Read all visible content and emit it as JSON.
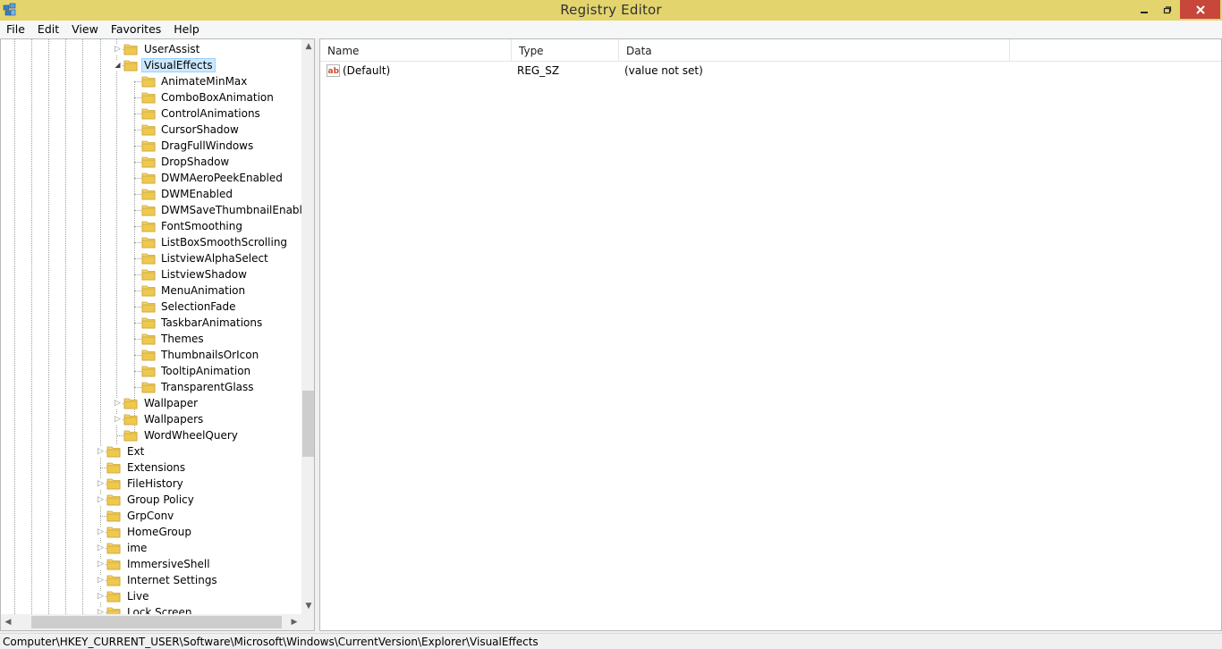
{
  "window": {
    "title": "Registry Editor"
  },
  "menu": [
    "File",
    "Edit",
    "View",
    "Favorites",
    "Help"
  ],
  "tree": {
    "rows": [
      {
        "label": "UserAssist",
        "level": 1,
        "expander": "collapsed",
        "selected": false
      },
      {
        "label": "VisualEffects",
        "level": 1,
        "expander": "expanded",
        "selected": true
      },
      {
        "label": "AnimateMinMax",
        "level": 2,
        "expander": "none",
        "selected": false
      },
      {
        "label": "ComboBoxAnimation",
        "level": 2,
        "expander": "none",
        "selected": false
      },
      {
        "label": "ControlAnimations",
        "level": 2,
        "expander": "none",
        "selected": false
      },
      {
        "label": "CursorShadow",
        "level": 2,
        "expander": "none",
        "selected": false
      },
      {
        "label": "DragFullWindows",
        "level": 2,
        "expander": "none",
        "selected": false
      },
      {
        "label": "DropShadow",
        "level": 2,
        "expander": "none",
        "selected": false
      },
      {
        "label": "DWMAeroPeekEnabled",
        "level": 2,
        "expander": "none",
        "selected": false
      },
      {
        "label": "DWMEnabled",
        "level": 2,
        "expander": "none",
        "selected": false
      },
      {
        "label": "DWMSaveThumbnailEnabled",
        "level": 2,
        "expander": "none",
        "selected": false
      },
      {
        "label": "FontSmoothing",
        "level": 2,
        "expander": "none",
        "selected": false
      },
      {
        "label": "ListBoxSmoothScrolling",
        "level": 2,
        "expander": "none",
        "selected": false
      },
      {
        "label": "ListviewAlphaSelect",
        "level": 2,
        "expander": "none",
        "selected": false
      },
      {
        "label": "ListviewShadow",
        "level": 2,
        "expander": "none",
        "selected": false
      },
      {
        "label": "MenuAnimation",
        "level": 2,
        "expander": "none",
        "selected": false
      },
      {
        "label": "SelectionFade",
        "level": 2,
        "expander": "none",
        "selected": false
      },
      {
        "label": "TaskbarAnimations",
        "level": 2,
        "expander": "none",
        "selected": false
      },
      {
        "label": "Themes",
        "level": 2,
        "expander": "none",
        "selected": false
      },
      {
        "label": "ThumbnailsOrIcon",
        "level": 2,
        "expander": "none",
        "selected": false
      },
      {
        "label": "TooltipAnimation",
        "level": 2,
        "expander": "none",
        "selected": false
      },
      {
        "label": "TransparentGlass",
        "level": 2,
        "expander": "none",
        "selected": false
      },
      {
        "label": "Wallpaper",
        "level": 1,
        "expander": "collapsed",
        "selected": false
      },
      {
        "label": "Wallpapers",
        "level": 1,
        "expander": "collapsed",
        "selected": false
      },
      {
        "label": "WordWheelQuery",
        "level": 1,
        "expander": "none",
        "selected": false
      },
      {
        "label": "Ext",
        "level": 0,
        "expander": "collapsed",
        "selected": false
      },
      {
        "label": "Extensions",
        "level": 0,
        "expander": "none",
        "selected": false
      },
      {
        "label": "FileHistory",
        "level": 0,
        "expander": "collapsed",
        "selected": false
      },
      {
        "label": "Group Policy",
        "level": 0,
        "expander": "collapsed",
        "selected": false
      },
      {
        "label": "GrpConv",
        "level": 0,
        "expander": "none",
        "selected": false
      },
      {
        "label": "HomeGroup",
        "level": 0,
        "expander": "collapsed",
        "selected": false
      },
      {
        "label": "ime",
        "level": 0,
        "expander": "collapsed",
        "selected": false
      },
      {
        "label": "ImmersiveShell",
        "level": 0,
        "expander": "collapsed",
        "selected": false
      },
      {
        "label": "Internet Settings",
        "level": 0,
        "expander": "collapsed",
        "selected": false
      },
      {
        "label": "Live",
        "level": 0,
        "expander": "collapsed",
        "selected": false
      },
      {
        "label": "Lock Screen",
        "level": 0,
        "expander": "collapsed",
        "selected": false
      }
    ]
  },
  "list": {
    "columns": [
      "Name",
      "Type",
      "Data"
    ],
    "rows": [
      {
        "icon": "string-value-icon",
        "name": "(Default)",
        "type": "REG_SZ",
        "data": "(value not set)"
      }
    ]
  },
  "status": {
    "path": "Computer\\HKEY_CURRENT_USER\\Software\\Microsoft\\Windows\\CurrentVersion\\Explorer\\VisualEffects"
  },
  "colors": {
    "titlebar": "#e3d46e",
    "close": "#c7473b",
    "selection": "#cce8ff",
    "folder": "#e8c44f"
  }
}
